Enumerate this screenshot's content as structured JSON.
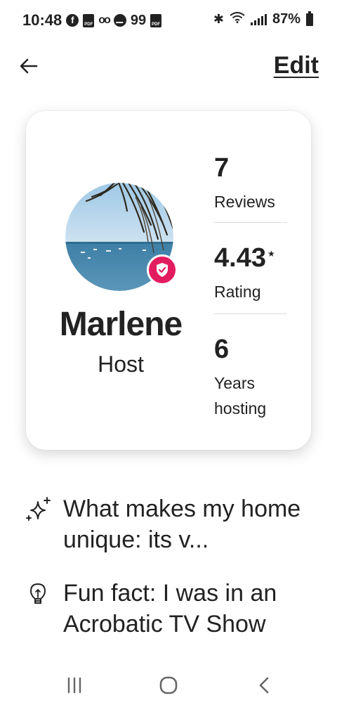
{
  "status_bar": {
    "time": "10:48",
    "notification_count": "99",
    "battery": "87%",
    "icons": [
      "facebook-icon",
      "pdf-icon",
      "voicemail-icon",
      "messenger-icon",
      "pdf-icon",
      "bluetooth-icon",
      "wifi-icon",
      "signal-icon",
      "battery-icon"
    ]
  },
  "header": {
    "back_icon": "back-arrow-icon",
    "edit_label": "Edit"
  },
  "profile": {
    "name": "Marlene",
    "role": "Host",
    "verified_icon": "verified-shield-icon",
    "accent_color": "#e31c5f"
  },
  "stats": [
    {
      "value": "7",
      "label": "Reviews",
      "star": ""
    },
    {
      "value": "4.43",
      "label": "Rating",
      "star": "★"
    },
    {
      "value": "6",
      "label": "Years hosting",
      "star": ""
    }
  ],
  "highlights": [
    {
      "icon": "sparkles-icon",
      "text": "What makes my home unique: its v..."
    },
    {
      "icon": "lightbulb-icon",
      "text": "Fun fact: I was in an Acrobatic TV Show"
    }
  ],
  "nav_bar": {
    "icons": [
      "recent-apps-icon",
      "home-icon",
      "back-icon"
    ]
  }
}
